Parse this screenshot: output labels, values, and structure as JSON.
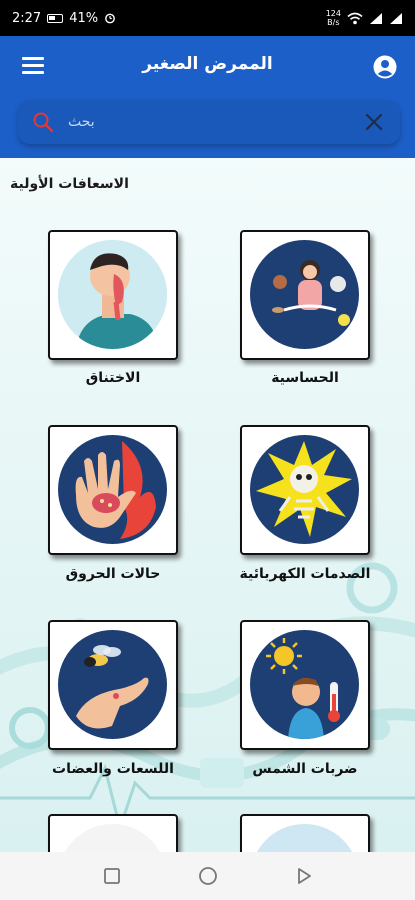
{
  "status_bar": {
    "time": "2:27",
    "battery": "41%",
    "net_speed_value": "124",
    "net_speed_unit": "B/s"
  },
  "header": {
    "title": "الممرض الصغير",
    "menu_icon": "hamburger-menu-icon",
    "account_icon": "account-circle-icon"
  },
  "search": {
    "placeholder": "بحث",
    "search_icon": "search-icon",
    "clear_icon": "close-icon"
  },
  "section": {
    "title": "الاسعافات الأولية"
  },
  "items": [
    {
      "label": "الحساسية",
      "icon": "allergy-illustration"
    },
    {
      "label": "الاختناق",
      "icon": "choking-illustration"
    },
    {
      "label": "الصدمات الكهربائية",
      "icon": "electric-shock-illustration"
    },
    {
      "label": "حالات الحروق",
      "icon": "burn-hand-illustration"
    },
    {
      "label": "ضربات الشمس",
      "icon": "sunstroke-illustration"
    },
    {
      "label": "اللسعات والعضات",
      "icon": "insect-sting-illustration"
    }
  ],
  "nav": {
    "recents_icon": "square-recents-icon",
    "home_icon": "circle-home-icon",
    "back_icon": "triangle-back-icon"
  },
  "colors": {
    "app_bar": "#1d5fc8",
    "card_circle": "#1d3f74",
    "background": "#e7f6f6"
  }
}
